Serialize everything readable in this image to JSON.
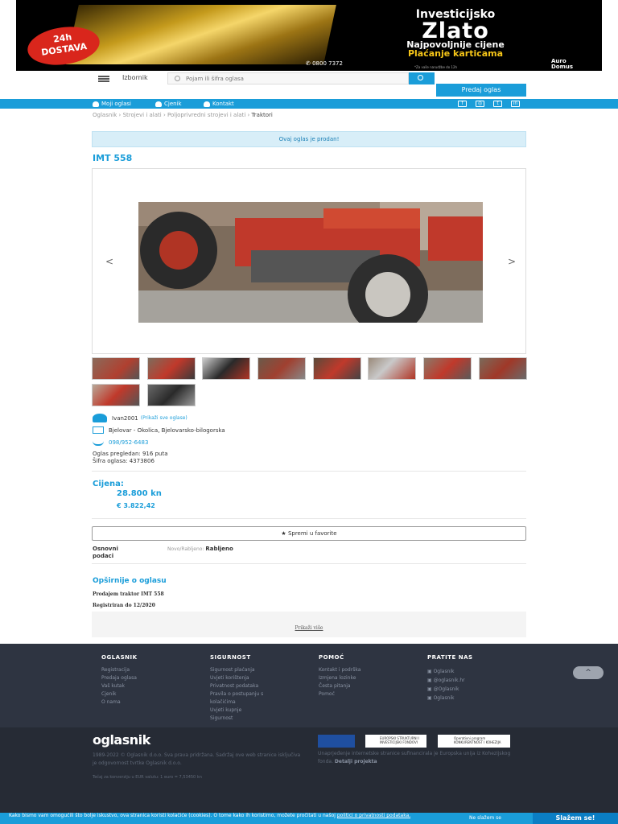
{
  "banner": {
    "badge_line1": "24h",
    "badge_line2": "DOSTAVA",
    "title_small": "Investicijsko",
    "title_big": "Zlato",
    "line1": "Najpovoljnije cijene",
    "line2": "Plaćanje karticama",
    "phone": "0800 7372",
    "small": "*Za vaše narudžbe do 12h",
    "logo_line1": "Auro",
    "logo_line2": "Domus"
  },
  "header": {
    "menu_label": "Izbornik",
    "search_placeholder": "Pojam ili šifra oglasa",
    "submit_label": "Predaj oglas"
  },
  "bluebar": {
    "moji_oglasi": "Moji oglasi",
    "cjenik": "Cjenik",
    "kontakt": "Kontakt"
  },
  "breadcrumbs": [
    "Oglasnik",
    "Strojevi i alati",
    "Poljoprivredni strojevi i alati",
    "Traktori"
  ],
  "breadcrumb_sep": "›",
  "ad": {
    "sold_notice": "Ovaj oglas je prodan!",
    "title": "IMT 558",
    "prev": "<",
    "next": ">",
    "user": "Ivan2001",
    "user_all": "(Prikaži sve oglase)",
    "location": "Bjelovar - Okolica, Bjelovarsko-bilogorska",
    "phone": "098/952-6483",
    "views": "Oglas pregledan: 916 puta",
    "code": "Šifra oglasa: 4373806",
    "price_label": "Cijena:",
    "price_kn": "28.800 kn",
    "price_eur": "€ 3.822,42",
    "favorite": "Spremi u favorite",
    "basic_label": "Osnovni podaci",
    "cond_label": "Novo/Rabljeno:",
    "cond_value": "Rabljeno",
    "desc_title": "Opširnije o oglasu",
    "desc_line1": "Prodajem traktor IMT 558",
    "desc_line2": "Registriran do 12/2020",
    "more": "Prikaži više"
  },
  "footer": {
    "col1": {
      "title": "OGLASNIK",
      "items": [
        "Registracija",
        "Predaja oglasa",
        "Vaš kutak",
        "Cjenik",
        "O nama"
      ]
    },
    "col2": {
      "title": "SIGURNOST",
      "items": [
        "Sigurnost plaćanja",
        "Uvjeti korištenja",
        "Privatnost podataka",
        "Pravila o postupanju s",
        "kolačićima",
        "Uvjeti kupnje",
        "Sigurnost"
      ]
    },
    "col3": {
      "title": "POMOĆ",
      "items": [
        "Kontakt i podrška",
        "Izmjena lozinke",
        "Česta pitanja",
        "Pomoć"
      ]
    },
    "col4": {
      "title": "PRATITE NAS",
      "items": [
        "Oglasnik",
        "@oglasnik.hr",
        "@Oglasnik",
        "Oglasnik"
      ]
    },
    "up": "^",
    "logo": "oglasnik",
    "copyright": "1989-2022 © Oglasnik d.o.o. Sva prava pridržana. Sadržaj ove web stranice isključiva je odgovornost tvrtke Oglasnik d.o.o.",
    "conversion": "Tečaj za konverziju u EUR valutu: 1 euro = 7,53450 kn",
    "eu_text": "Unaprjeđenje internetske stranice sufinancirala je Europska unija iz Kohezijskog fonda.",
    "eu_link": "Detalji projekta",
    "eu_logo2": "EUROPSKI STRUKTURNI I INVESTICIJSKI FONDOVI",
    "eu_logo3": "Operativni program KONKURENTNOST I KOHEZIJA"
  },
  "cookie": {
    "text": "Kako bismo vam omogućili što bolje iskustvo, ova stranica koristi kolačiće (cookies). O tome kako ih koristimo, možete pročitati u našoj",
    "link": "politici o privatnosti podataka.",
    "decline": "Ne slažem se",
    "accept": "Slažem se!"
  }
}
